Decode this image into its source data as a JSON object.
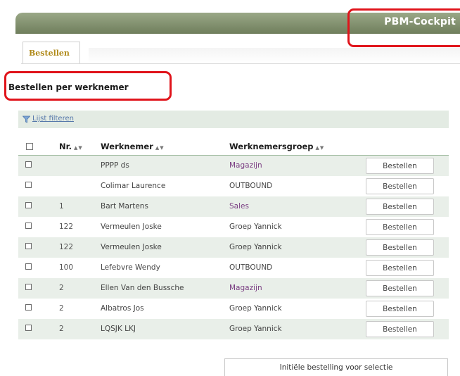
{
  "app": {
    "title": "PBM-Cockpit"
  },
  "tabs": [
    {
      "label": "Bestellen"
    }
  ],
  "page": {
    "title": "Bestellen per werknemer"
  },
  "filter": {
    "label": "Lijst filteren"
  },
  "table": {
    "columns": [
      {
        "label": "Nr."
      },
      {
        "label": "Werknemer"
      },
      {
        "label": "Werknemersgroep"
      }
    ],
    "rows": [
      {
        "nr": "",
        "name": "PPPP ds",
        "group": "Magazijn",
        "action": "Bestellen"
      },
      {
        "nr": "",
        "name": "Colimar Laurence",
        "group": "OUTBOUND",
        "action": "Bestellen"
      },
      {
        "nr": "1",
        "name": "Bart Martens",
        "group": "Sales",
        "action": "Bestellen"
      },
      {
        "nr": "122",
        "name": "Vermeulen Joske",
        "group": "Groep Yannick",
        "action": "Bestellen"
      },
      {
        "nr": "122",
        "name": "Vermeulen Joske",
        "group": "Groep Yannick",
        "action": "Bestellen"
      },
      {
        "nr": "100",
        "name": "Lefebvre Wendy",
        "group": "OUTBOUND",
        "action": "Bestellen"
      },
      {
        "nr": "2",
        "name": "Ellen Van den Bussche",
        "group": "Magazijn",
        "action": "Bestellen"
      },
      {
        "nr": "2",
        "name": "Albatros Jos",
        "group": "Groep Yannick",
        "action": "Bestellen"
      },
      {
        "nr": "2",
        "name": "LQSJK LKJ",
        "group": "Groep Yannick",
        "action": "Bestellen"
      }
    ]
  },
  "footer": {
    "initial_order_button": "Initiële bestelling voor selectie"
  },
  "colors": {
    "header_bar": "#7c8b68",
    "tab_text": "#b08a1a",
    "highlight": "#e0141b",
    "row_alt": "#e9efe9",
    "link": "#5577aa",
    "group_link": "#7a3d82"
  },
  "icons": {
    "filter": "funnel-icon",
    "sort": "sort-arrows-icon"
  }
}
